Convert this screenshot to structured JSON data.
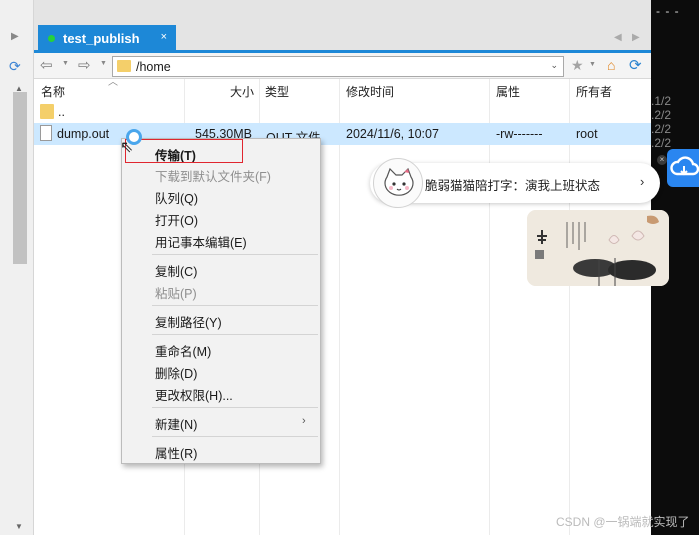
{
  "tab": {
    "title": "test_publish",
    "close": "×"
  },
  "toolbar": {
    "path": "/home"
  },
  "columns": {
    "name": "名称",
    "size": "大小",
    "type": "类型",
    "mtime": "修改时间",
    "attr": "属性",
    "owner": "所有者"
  },
  "rows": [
    {
      "name": "..",
      "size": "",
      "type": "",
      "mtime": "",
      "attr": "",
      "owner": ""
    },
    {
      "name": "dump.out",
      "size": "545.30MB",
      "type": "OUT 文件",
      "mtime": "2024/11/6, 10:07",
      "attr": "-rw-------",
      "owner": "root"
    }
  ],
  "context_menu": {
    "transfer": "传输(T)",
    "download_default": "下载到默认文件夹(F)",
    "queue": "队列(Q)",
    "open": "打开(O)",
    "edit_notepad": "用记事本编辑(E)",
    "copy": "复制(C)",
    "paste": "粘贴(P)",
    "copy_path": "复制路径(Y)",
    "rename": "重命名(M)",
    "delete": "删除(D)",
    "chmod": "更改权限(H)...",
    "new": "新建(N)",
    "properties": "属性(R)"
  },
  "widget": {
    "text": "脆弱猫猫陪打字：演我上班状态"
  },
  "right_panel": {
    "dashes": "- - -",
    "lines": [
      ".1/2",
      ".2/2",
      ".2/2",
      ".2/2"
    ]
  },
  "watermark": "CSDN @一锅端就实现了"
}
